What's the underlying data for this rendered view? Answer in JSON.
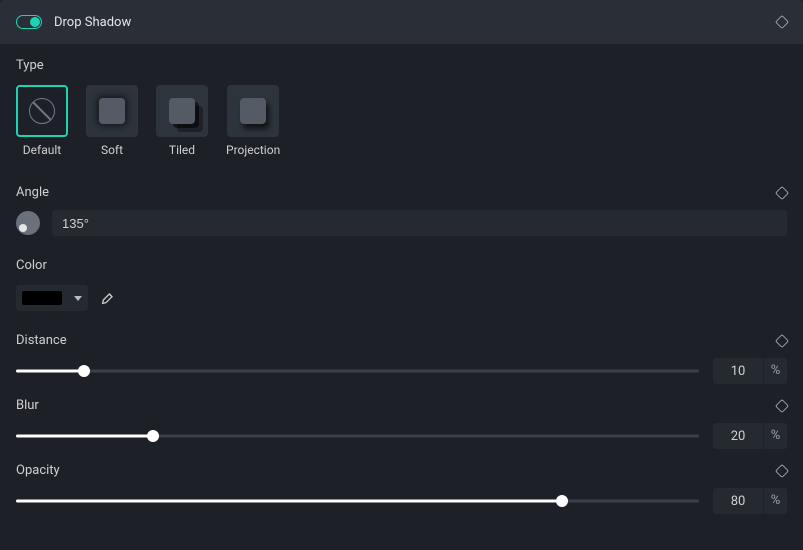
{
  "header": {
    "title": "Drop Shadow",
    "enabled": true
  },
  "type": {
    "label": "Type",
    "options": [
      {
        "key": "default",
        "label": "Default"
      },
      {
        "key": "soft",
        "label": "Soft"
      },
      {
        "key": "tiled",
        "label": "Tiled"
      },
      {
        "key": "projection",
        "label": "Projection"
      }
    ],
    "selected": "default"
  },
  "angle": {
    "label": "Angle",
    "value": "135°"
  },
  "color": {
    "label": "Color",
    "value": "#000000"
  },
  "distance": {
    "label": "Distance",
    "value": 10,
    "unit": "%",
    "max": 100
  },
  "blur": {
    "label": "Blur",
    "value": 20,
    "unit": "%",
    "max": 100
  },
  "opacity": {
    "label": "Opacity",
    "value": 80,
    "unit": "%",
    "max": 100
  }
}
